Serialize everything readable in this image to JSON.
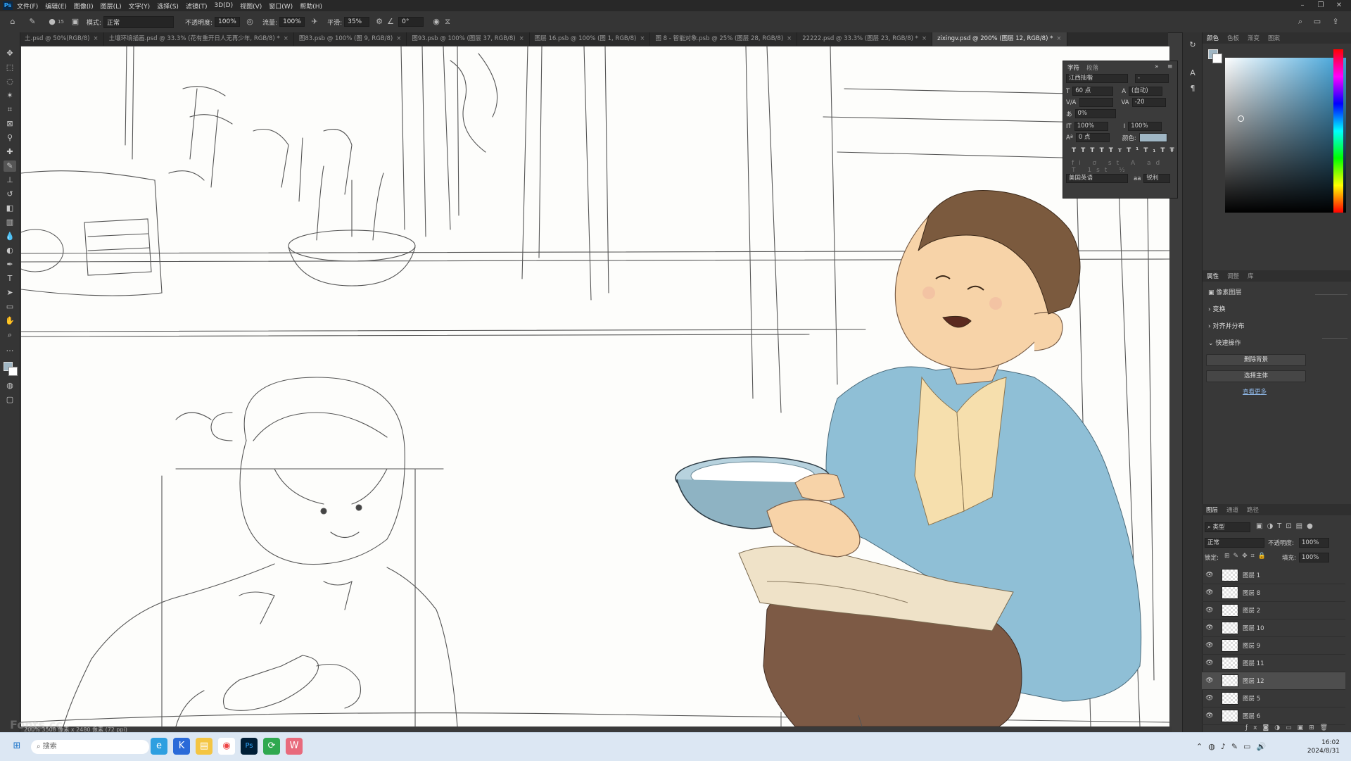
{
  "menubar": {
    "logo": "Ps",
    "items": [
      "文件(F)",
      "编辑(E)",
      "图像(I)",
      "图层(L)",
      "文字(Y)",
      "选择(S)",
      "滤镜(T)",
      "3D(D)",
      "视图(V)",
      "窗口(W)",
      "帮助(H)"
    ]
  },
  "options": {
    "mode_label": "模式:",
    "mode_value": "正常",
    "opacity_label": "不透明度:",
    "opacity_value": "100%",
    "flow_label": "流量:",
    "flow_value": "100%",
    "smooth_label": "平滑:",
    "smooth_value": "35%",
    "angle_value": "0°",
    "brush_size": "15"
  },
  "tabs": [
    "土.psd @ 50%(RGB/8)",
    "土壤环境插画.psd @ 33.3% (花有重开日人无再少年, RGB/8) *",
    "图83.psb @ 100% (图 9, RGB/8)",
    "图93.psb @ 100% (图层 37, RGB/8)",
    "图层 16.psb @ 100% (图 1, RGB/8)",
    "图 8 - 智能对象.psb @ 25% (图层 28, RGB/8)",
    "22222.psd @ 33.3% (图层 23, RGB/8) *",
    "zixingv.psd @ 200% (图层 12, RGB/8) *"
  ],
  "tab_close": "×",
  "character_panel": {
    "tab1": "字符",
    "tab2": "段落",
    "font_family": "江西拙楷",
    "font_style": "-",
    "size": "60 点",
    "leading": "(自动)",
    "kerning": "",
    "tracking": "-20",
    "scale_label": "0%",
    "vscale": "100%",
    "hscale": "100%",
    "baseline": "0 点",
    "color_label": "颜色:",
    "language": "美国英语",
    "aa_label": "aa",
    "aa_value": "锐利",
    "styles": [
      "T",
      "T",
      "TT",
      "Tт",
      "T¹",
      "T₁",
      "T",
      "Ŧ"
    ]
  },
  "color_panel": {
    "tabs": [
      "颜色",
      "色板",
      "渐变",
      "图案"
    ],
    "accent": "#3aa0d8"
  },
  "properties": {
    "tabs": [
      "属性",
      "调整",
      "库"
    ],
    "type_label": "像素图层",
    "sections": [
      "变换",
      "对齐并分布",
      "快速操作"
    ],
    "buttons": [
      "删除背景",
      "选择主体"
    ],
    "more_link": "查看更多"
  },
  "layers_panel": {
    "tabs": [
      "图层",
      "通道",
      "路径"
    ],
    "filter_label": "类型",
    "blend_mode": "正常",
    "opacity_label": "不透明度:",
    "opacity_value": "100%",
    "lock_label": "锁定:",
    "fill_label": "填充:",
    "fill_value": "100%",
    "layers": [
      "图层 1",
      "图层 8",
      "图层 2",
      "图层 10",
      "图层 9",
      "图层 11",
      "图层 12",
      "图层 5",
      "图层 6"
    ],
    "active_layer": "图层 12"
  },
  "status": "200%   3508 像素 x 2480 像素 (72 ppi)",
  "watermark": "Fonts.cc",
  "taskbar": {
    "search_placeholder": "搜索",
    "time": "16:02",
    "date": "2024/8/31"
  }
}
